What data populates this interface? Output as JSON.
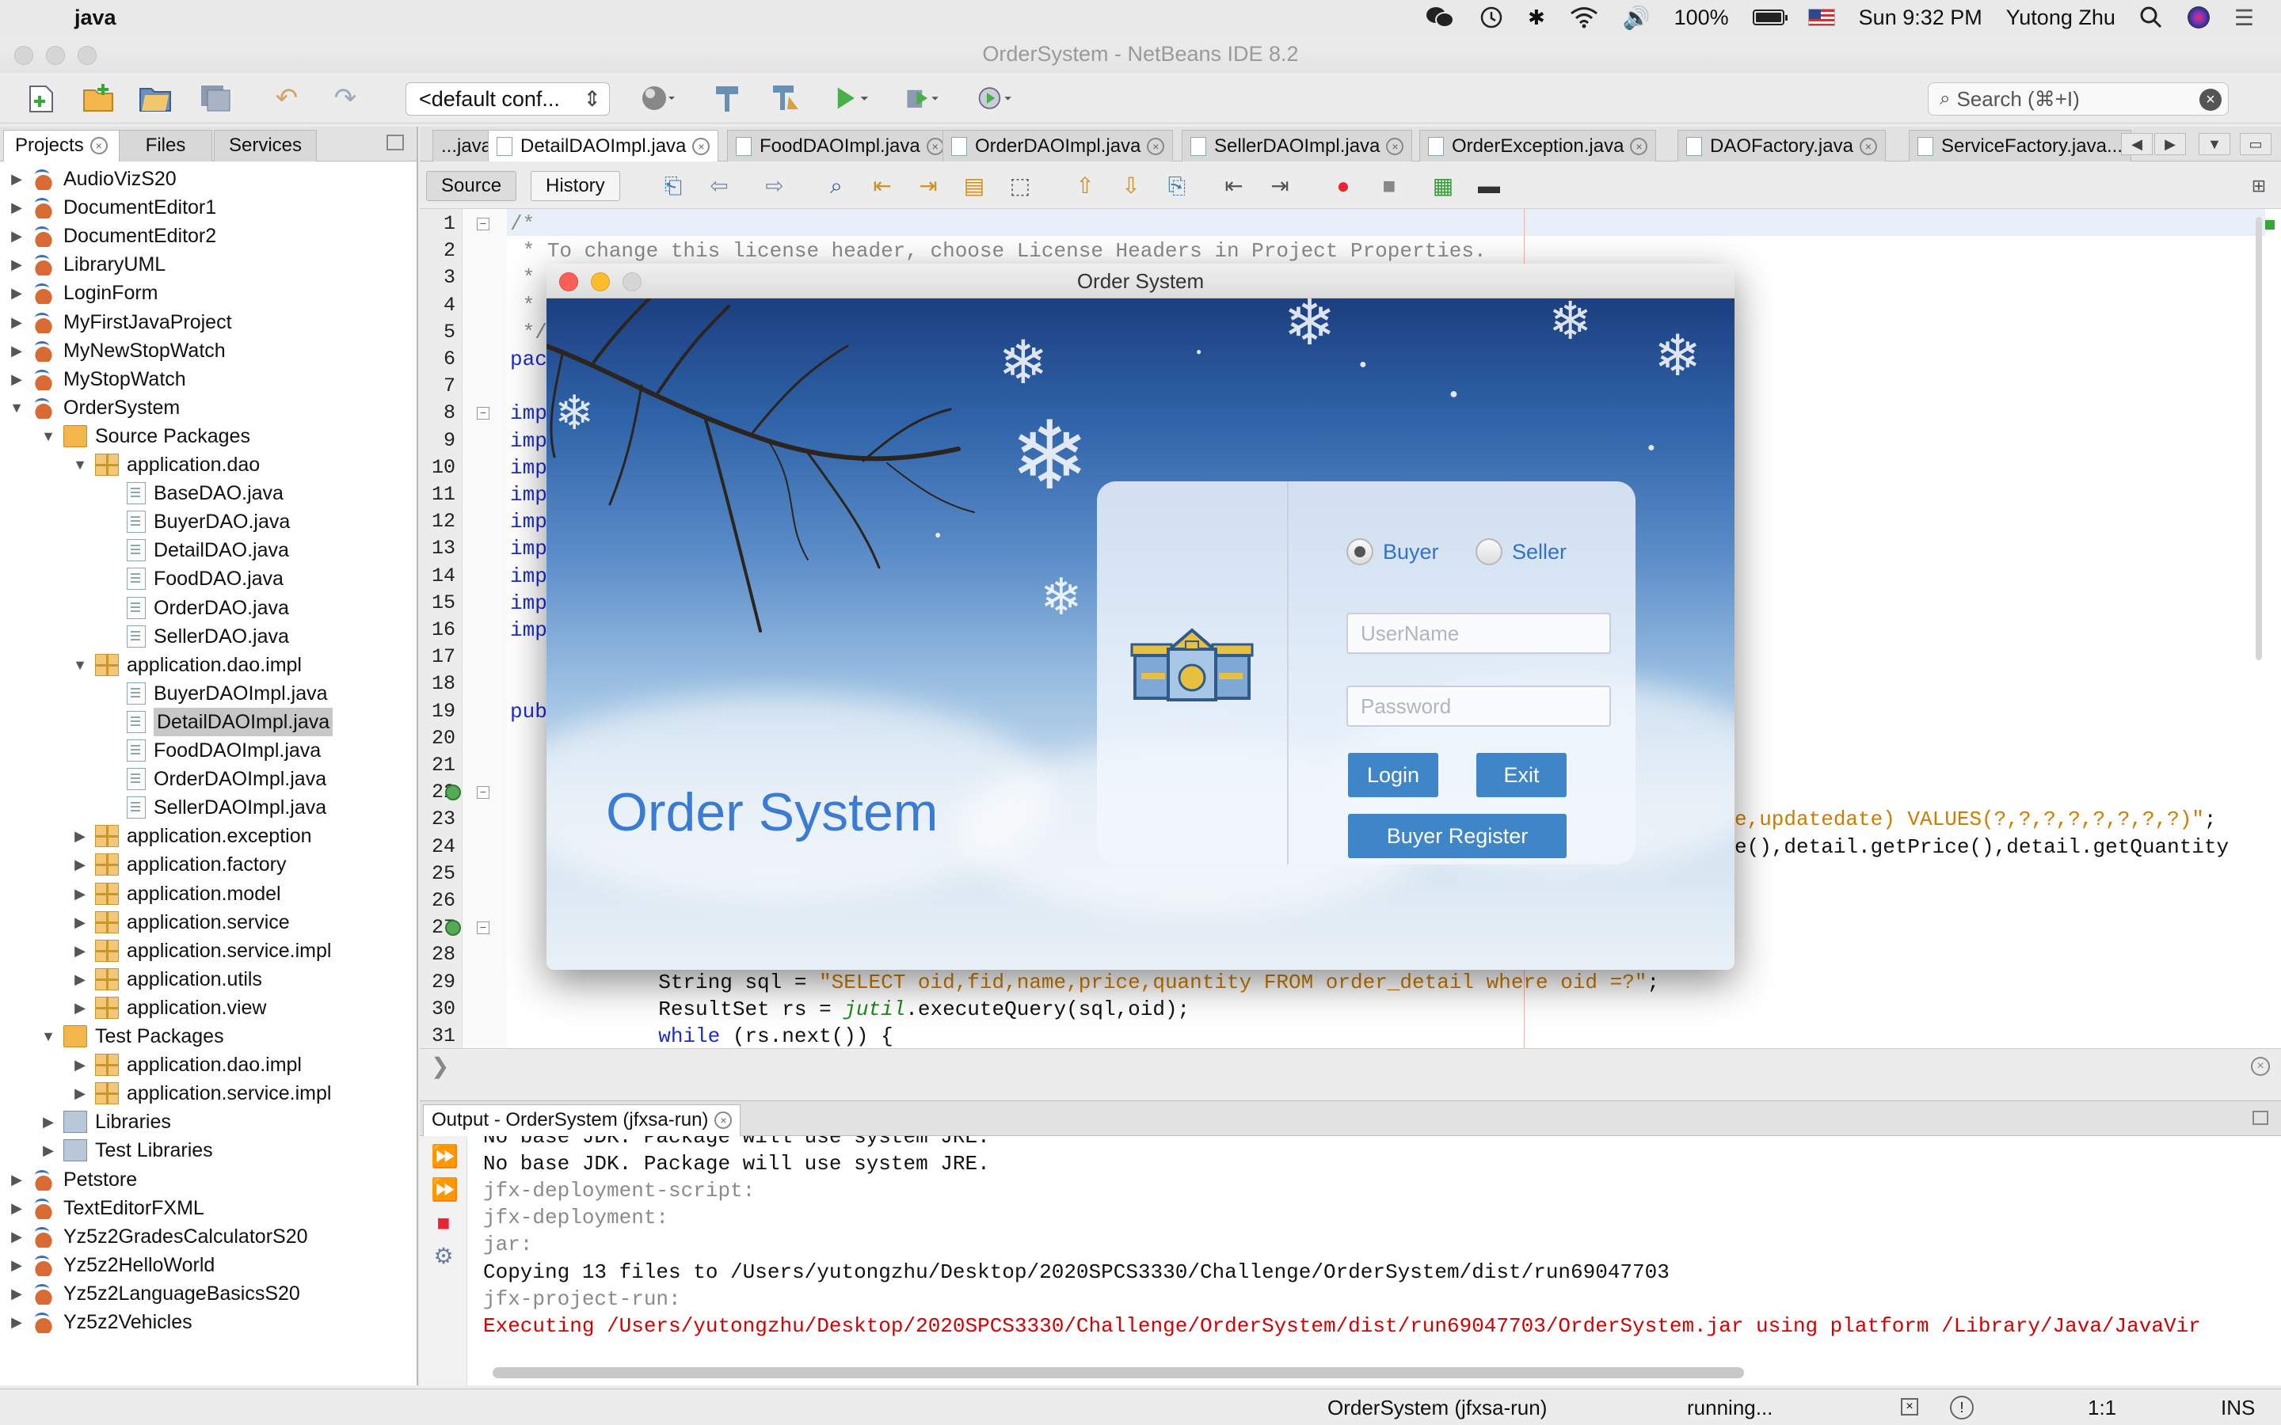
{
  "menubar": {
    "app_name": "java",
    "battery": "100%",
    "battery_level": 1.0,
    "clock": "Sun 9:32 PM",
    "user": "Yutong Zhu"
  },
  "window": {
    "title": "OrderSystem - NetBeans IDE 8.2"
  },
  "toolbar": {
    "config": "<default conf...",
    "search_placeholder": "Search (⌘+I)"
  },
  "left_panel": {
    "tabs": [
      "Projects",
      "Files",
      "Services"
    ],
    "tree": [
      {
        "label": "AudioVizS20",
        "type": "project",
        "level": 0,
        "arrow": "▶"
      },
      {
        "label": "DocumentEditor1",
        "type": "project",
        "level": 0,
        "arrow": "▶"
      },
      {
        "label": "DocumentEditor2",
        "type": "project",
        "level": 0,
        "arrow": "▶"
      },
      {
        "label": "LibraryUML",
        "type": "project",
        "level": 0,
        "arrow": "▶"
      },
      {
        "label": "LoginForm",
        "type": "project",
        "level": 0,
        "arrow": "▶"
      },
      {
        "label": "MyFirstJavaProject",
        "type": "project",
        "level": 0,
        "arrow": "▶"
      },
      {
        "label": "MyNewStopWatch",
        "type": "project",
        "level": 0,
        "arrow": "▶"
      },
      {
        "label": "MyStopWatch",
        "type": "project",
        "level": 0,
        "arrow": "▶"
      },
      {
        "label": "OrderSystem",
        "type": "project",
        "level": 0,
        "arrow": "▼"
      },
      {
        "label": "Source Packages",
        "type": "folder",
        "level": 1,
        "arrow": "▼"
      },
      {
        "label": "application.dao",
        "type": "pkg",
        "level": 2,
        "arrow": "▼"
      },
      {
        "label": "BaseDAO.java",
        "type": "java",
        "level": 3,
        "arrow": ""
      },
      {
        "label": "BuyerDAO.java",
        "type": "java",
        "level": 3,
        "arrow": ""
      },
      {
        "label": "DetailDAO.java",
        "type": "java",
        "level": 3,
        "arrow": ""
      },
      {
        "label": "FoodDAO.java",
        "type": "java",
        "level": 3,
        "arrow": ""
      },
      {
        "label": "OrderDAO.java",
        "type": "java",
        "level": 3,
        "arrow": ""
      },
      {
        "label": "SellerDAO.java",
        "type": "java",
        "level": 3,
        "arrow": ""
      },
      {
        "label": "application.dao.impl",
        "type": "pkg",
        "level": 2,
        "arrow": "▼"
      },
      {
        "label": "BuyerDAOImpl.java",
        "type": "java",
        "level": 3,
        "arrow": ""
      },
      {
        "label": "DetailDAOImpl.java",
        "type": "java",
        "level": 3,
        "arrow": "",
        "selected": true
      },
      {
        "label": "FoodDAOImpl.java",
        "type": "java",
        "level": 3,
        "arrow": ""
      },
      {
        "label": "OrderDAOImpl.java",
        "type": "java",
        "level": 3,
        "arrow": ""
      },
      {
        "label": "SellerDAOImpl.java",
        "type": "java",
        "level": 3,
        "arrow": ""
      },
      {
        "label": "application.exception",
        "type": "pkg",
        "level": 2,
        "arrow": "▶"
      },
      {
        "label": "application.factory",
        "type": "pkg",
        "level": 2,
        "arrow": "▶"
      },
      {
        "label": "application.model",
        "type": "pkg",
        "level": 2,
        "arrow": "▶"
      },
      {
        "label": "application.service",
        "type": "pkg",
        "level": 2,
        "arrow": "▶"
      },
      {
        "label": "application.service.impl",
        "type": "pkg",
        "level": 2,
        "arrow": "▶"
      },
      {
        "label": "application.utils",
        "type": "pkg",
        "level": 2,
        "arrow": "▶"
      },
      {
        "label": "application.view",
        "type": "pkg",
        "level": 2,
        "arrow": "▶"
      },
      {
        "label": "Test Packages",
        "type": "folder",
        "level": 1,
        "arrow": "▼"
      },
      {
        "label": "application.dao.impl",
        "type": "pkg",
        "level": 2,
        "arrow": "▶"
      },
      {
        "label": "application.service.impl",
        "type": "pkg",
        "level": 2,
        "arrow": "▶"
      },
      {
        "label": "Libraries",
        "type": "lib",
        "level": 1,
        "arrow": "▶"
      },
      {
        "label": "Test Libraries",
        "type": "lib",
        "level": 1,
        "arrow": "▶"
      },
      {
        "label": "Petstore",
        "type": "project",
        "level": 0,
        "arrow": "▶"
      },
      {
        "label": "TextEditorFXML",
        "type": "project",
        "level": 0,
        "arrow": "▶"
      },
      {
        "label": "Yz5z2GradesCalculatorS20",
        "type": "project",
        "level": 0,
        "arrow": "▶"
      },
      {
        "label": "Yz5z2HelloWorld",
        "type": "project",
        "level": 0,
        "arrow": "▶"
      },
      {
        "label": "Yz5z2LanguageBasicsS20",
        "type": "project",
        "level": 0,
        "arrow": "▶"
      },
      {
        "label": "Yz5z2Vehicles",
        "type": "project",
        "level": 0,
        "arrow": "▶"
      }
    ]
  },
  "editor": {
    "tabs": [
      {
        "label": "...java",
        "active": false
      },
      {
        "label": "DetailDAOImpl.java",
        "active": true
      },
      {
        "label": "FoodDAOImpl.java",
        "active": false
      },
      {
        "label": "OrderDAOImpl.java",
        "active": false
      },
      {
        "label": "SellerDAOImpl.java",
        "active": false
      },
      {
        "label": "OrderException.java",
        "active": false
      },
      {
        "label": "DAOFactory.java",
        "active": false
      },
      {
        "label": "ServiceFactory.java...",
        "active": false
      }
    ],
    "source_label": "Source",
    "history_label": "History",
    "line_numbers": [
      "1",
      "2",
      "3",
      "4",
      "5",
      "6",
      "7",
      "8",
      "9",
      "10",
      "11",
      "12",
      "13",
      "14",
      "15",
      "16",
      "17",
      "18",
      "19",
      "20",
      "21",
      "22",
      "23",
      "24",
      "25",
      "26",
      "27",
      "28",
      "29",
      "30",
      "31"
    ],
    "code_lines": [
      {
        "n": 1,
        "segments": [
          {
            "t": "/*",
            "c": "cmt"
          }
        ]
      },
      {
        "n": 2,
        "segments": [
          {
            "t": " * To change this license header, choose License Headers in Project Properties.",
            "c": "cmt"
          }
        ]
      },
      {
        "n": 3,
        "segments": [
          {
            "t": " *",
            "c": "cmt"
          }
        ]
      },
      {
        "n": 4,
        "segments": [
          {
            "t": " *",
            "c": "cmt"
          }
        ]
      },
      {
        "n": 5,
        "segments": [
          {
            "t": " */",
            "c": "cmt"
          }
        ]
      },
      {
        "n": 6,
        "segments": [
          {
            "t": "pac",
            "c": "kw"
          }
        ]
      },
      {
        "n": 8,
        "segments": [
          {
            "t": "imp",
            "c": "kw"
          }
        ]
      },
      {
        "n": 9,
        "segments": [
          {
            "t": "imp",
            "c": "kw"
          }
        ]
      },
      {
        "n": 10,
        "segments": [
          {
            "t": "imp",
            "c": "kw"
          }
        ]
      },
      {
        "n": 11,
        "segments": [
          {
            "t": "imp",
            "c": "kw"
          }
        ]
      },
      {
        "n": 12,
        "segments": [
          {
            "t": "imp",
            "c": "kw"
          }
        ]
      },
      {
        "n": 13,
        "segments": [
          {
            "t": "imp",
            "c": "kw"
          }
        ]
      },
      {
        "n": 14,
        "segments": [
          {
            "t": "imp",
            "c": "kw"
          }
        ]
      },
      {
        "n": 15,
        "segments": [
          {
            "t": "imp",
            "c": "kw"
          }
        ]
      },
      {
        "n": 16,
        "segments": [
          {
            "t": "imp",
            "c": "kw"
          }
        ]
      },
      {
        "n": 19,
        "segments": [
          {
            "t": "pub",
            "c": "kw"
          }
        ]
      },
      {
        "n": 29,
        "segments": [
          {
            "t": "            String sql = ",
            "c": ""
          },
          {
            "t": "\"SELECT oid,fid,name,price,quantity FROM order_detail where oid =?\"",
            "c": "str"
          },
          {
            "t": ";",
            "c": ""
          }
        ]
      },
      {
        "n": 30,
        "segments": [
          {
            "t": "            ResultSet rs = ",
            "c": ""
          },
          {
            "t": "jutil",
            "c": "itl"
          },
          {
            "t": ".executeQuery(sql,oid);",
            "c": ""
          }
        ]
      },
      {
        "n": 31,
        "segments": [
          {
            "t": "            ",
            "c": ""
          },
          {
            "t": "while",
            "c": "kw"
          },
          {
            "t": " (rs.next()) {",
            "c": ""
          }
        ]
      }
    ],
    "right_fragments": [
      {
        "n": 23,
        "segments": [
          {
            "t": "e,updatedate) VALUES(?,?,?,?,?,?,?,?)\"",
            "c": "str"
          },
          {
            "t": ";",
            "c": ""
          }
        ]
      },
      {
        "n": 24,
        "segments": [
          {
            "t": "e(),detail.getPrice(),detail.getQuantity",
            "c": ""
          }
        ]
      }
    ]
  },
  "output": {
    "title": "Output - OrderSystem (jfxsa-run)",
    "lines": [
      {
        "text": "No base JDK. Package will use system JRE.",
        "style": ""
      },
      {
        "text": "No base JDK. Package will use system JRE.",
        "style": ""
      },
      {
        "text": "jfx-deployment-script:",
        "style": "gray"
      },
      {
        "text": "jfx-deployment:",
        "style": "gray"
      },
      {
        "text": "jar:",
        "style": "gray"
      },
      {
        "text": "Copying 13 files to /Users/yutongzhu/Desktop/2020SPCS3330/Challenge/OrderSystem/dist/run69047703",
        "style": ""
      },
      {
        "text": "jfx-project-run:",
        "style": "gray"
      },
      {
        "text": "Executing /Users/yutongzhu/Desktop/2020SPCS3330/Challenge/OrderSystem/dist/run69047703/OrderSystem.jar using platform /Library/Java/JavaVir",
        "style": "red"
      }
    ]
  },
  "statusbar": {
    "task": "OrderSystem (jfxsa-run)",
    "state": "running...",
    "position": "1:1",
    "mode": "INS"
  },
  "dialog": {
    "title": "Order System",
    "big_title": "Order System",
    "role_buyer": "Buyer",
    "role_seller": "Seller",
    "username_placeholder": "UserName",
    "password_placeholder": "Password",
    "login_label": "Login",
    "exit_label": "Exit",
    "register_label": "Buyer Register"
  }
}
